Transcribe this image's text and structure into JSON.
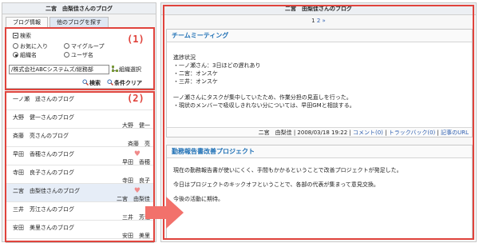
{
  "left_panel": {
    "title": "二宮　由梨佳さんのブログ",
    "tabs": [
      "ブログ情報",
      "他のブログを探す"
    ],
    "annotation_1": "(1)",
    "annotation_2": "(2)",
    "search": {
      "toggle_label": "検索",
      "radio_favorites": "お気に入り",
      "radio_mygroup": "マイグループ",
      "radio_org": "組織名",
      "radio_username": "ユーザ名",
      "org_value": "/株式会社ABCシステムズ/総務部",
      "org_select_label": "組織選択",
      "search_button": "検索",
      "clear_button": "条件クリア"
    },
    "blog_list": [
      {
        "title": "一ノ瀬　遥さんのブログ",
        "author": "",
        "heart": false
      },
      {
        "title": "大野　健一さんのブログ",
        "author": "大野　健一",
        "heart": false
      },
      {
        "title": "斉藤　亮さんのブログ",
        "author": "斉藤　亮",
        "heart": false
      },
      {
        "title": "早田　香穂さんのブログ",
        "author": "早田　香穂",
        "heart": true
      },
      {
        "title": "寺田　良子さんのブログ",
        "author": "寺田　良子",
        "heart": false
      },
      {
        "title": "二宮　由梨佳さんのブログ",
        "author": "二宮　由梨佳",
        "heart": true
      },
      {
        "title": "三井　芳江さんのブログ",
        "author": "三井　芳江",
        "heart": false
      },
      {
        "title": "安田　美里さんのブログ",
        "author": "安田　美里",
        "heart": false
      }
    ]
  },
  "right_panel": {
    "title": "二宮　由梨佳さんのブログ",
    "pager": {
      "current": "1",
      "next_page": "2",
      "next_arrow": "»"
    },
    "posts": [
      {
        "title": "チームミーティング",
        "lines": [
          "進捗状況",
          "・一ノ瀬さん：3日ほどの遅れあり",
          "・二宮：オンスケ",
          "・三井：オンスケ",
          "",
          "一ノ瀬さんにタスクが集中していたため、作業分担の見直しを行った。",
          "・現状のメンバーで吸収しきれない分については、早田GMと相談する。"
        ],
        "footer": {
          "author": "二宮　由梨佳",
          "datetime": "2008/03/18 19:22",
          "comment": "コメント(0)",
          "trackback": "トラックバック(0)",
          "url": "記事のURL"
        }
      },
      {
        "title": "勤務報告書改善プロジェクト",
        "lines": [
          "現在の勤務報告書が使いにくく、手間もかかるということで改善プロジェクトが発足した。",
          "",
          "今日はプロジェクトのキックオフということで、各部の代表が集まって意見交換。",
          "",
          "今後の活動に期待。"
        ]
      }
    ]
  },
  "colors": {
    "annotation_red": "#e0433c",
    "link_blue": "#2f5fb0",
    "post_title_blue": "#1d6fb5",
    "heart_pink": "#f08a8a"
  }
}
